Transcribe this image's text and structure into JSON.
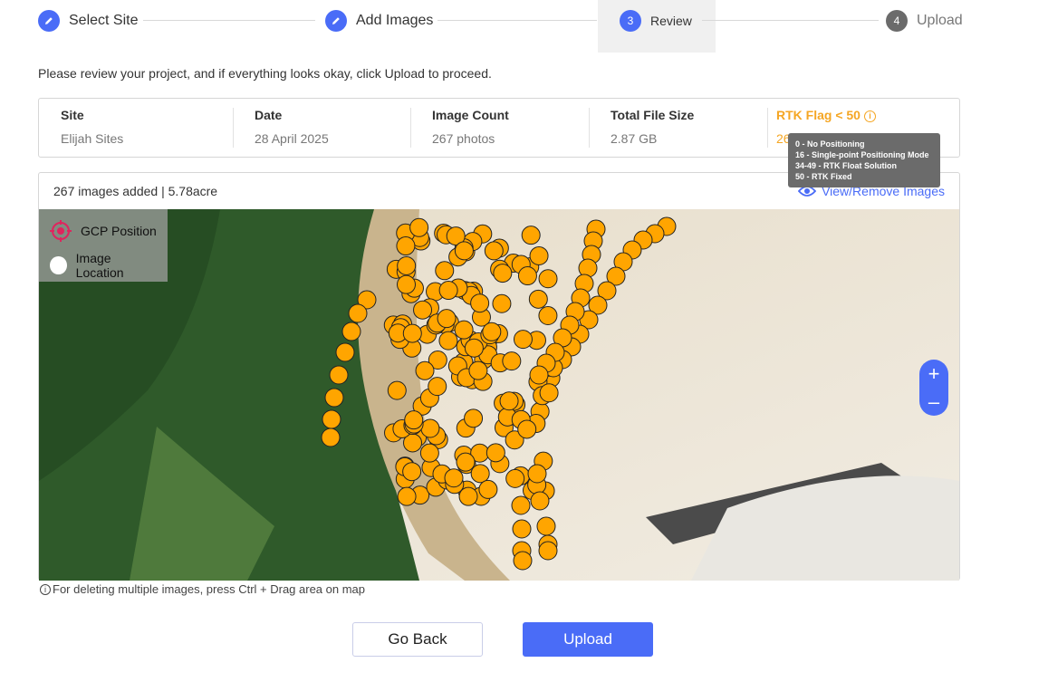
{
  "stepper": {
    "steps": [
      {
        "label": "Select Site",
        "icon": "pencil-icon",
        "state": "done"
      },
      {
        "label": "Add Images",
        "icon": "pencil-icon",
        "state": "done"
      },
      {
        "label": "Review",
        "number": "3",
        "state": "active"
      },
      {
        "label": "Upload",
        "number": "4",
        "state": "todo"
      }
    ]
  },
  "instructions": "Please review your project, and if everything looks okay, click Upload to proceed.",
  "summary": {
    "site": {
      "label": "Site",
      "value": "Elijah Sites"
    },
    "date": {
      "label": "Date",
      "value": "28 April 2025"
    },
    "image_count": {
      "label": "Image Count",
      "value": "267 photos"
    },
    "file_size": {
      "label": "Total File Size",
      "value": "2.87 GB"
    },
    "rtk": {
      "label": "RTK Flag < 50",
      "value": "26"
    }
  },
  "tooltip": {
    "lines": [
      "0 - No Positioning",
      "16 - Single-point Positioning Mode",
      "34-49 - RTK Float Solution",
      "50 - RTK Fixed"
    ]
  },
  "map_panel": {
    "images_added": "267 images added | 5.78acre",
    "view_link": "View/Remove Images",
    "legend": {
      "gcp": "GCP Position",
      "image": "Image Location"
    },
    "zoom_in": "+",
    "zoom_out": "–"
  },
  "hint": "For deleting multiple images, press Ctrl + Drag area on map",
  "buttons": {
    "back": "Go Back",
    "upload": "Upload"
  },
  "colors": {
    "accent": "#4a6cf7",
    "warning": "#f5a623",
    "marker": "#ffa500"
  }
}
